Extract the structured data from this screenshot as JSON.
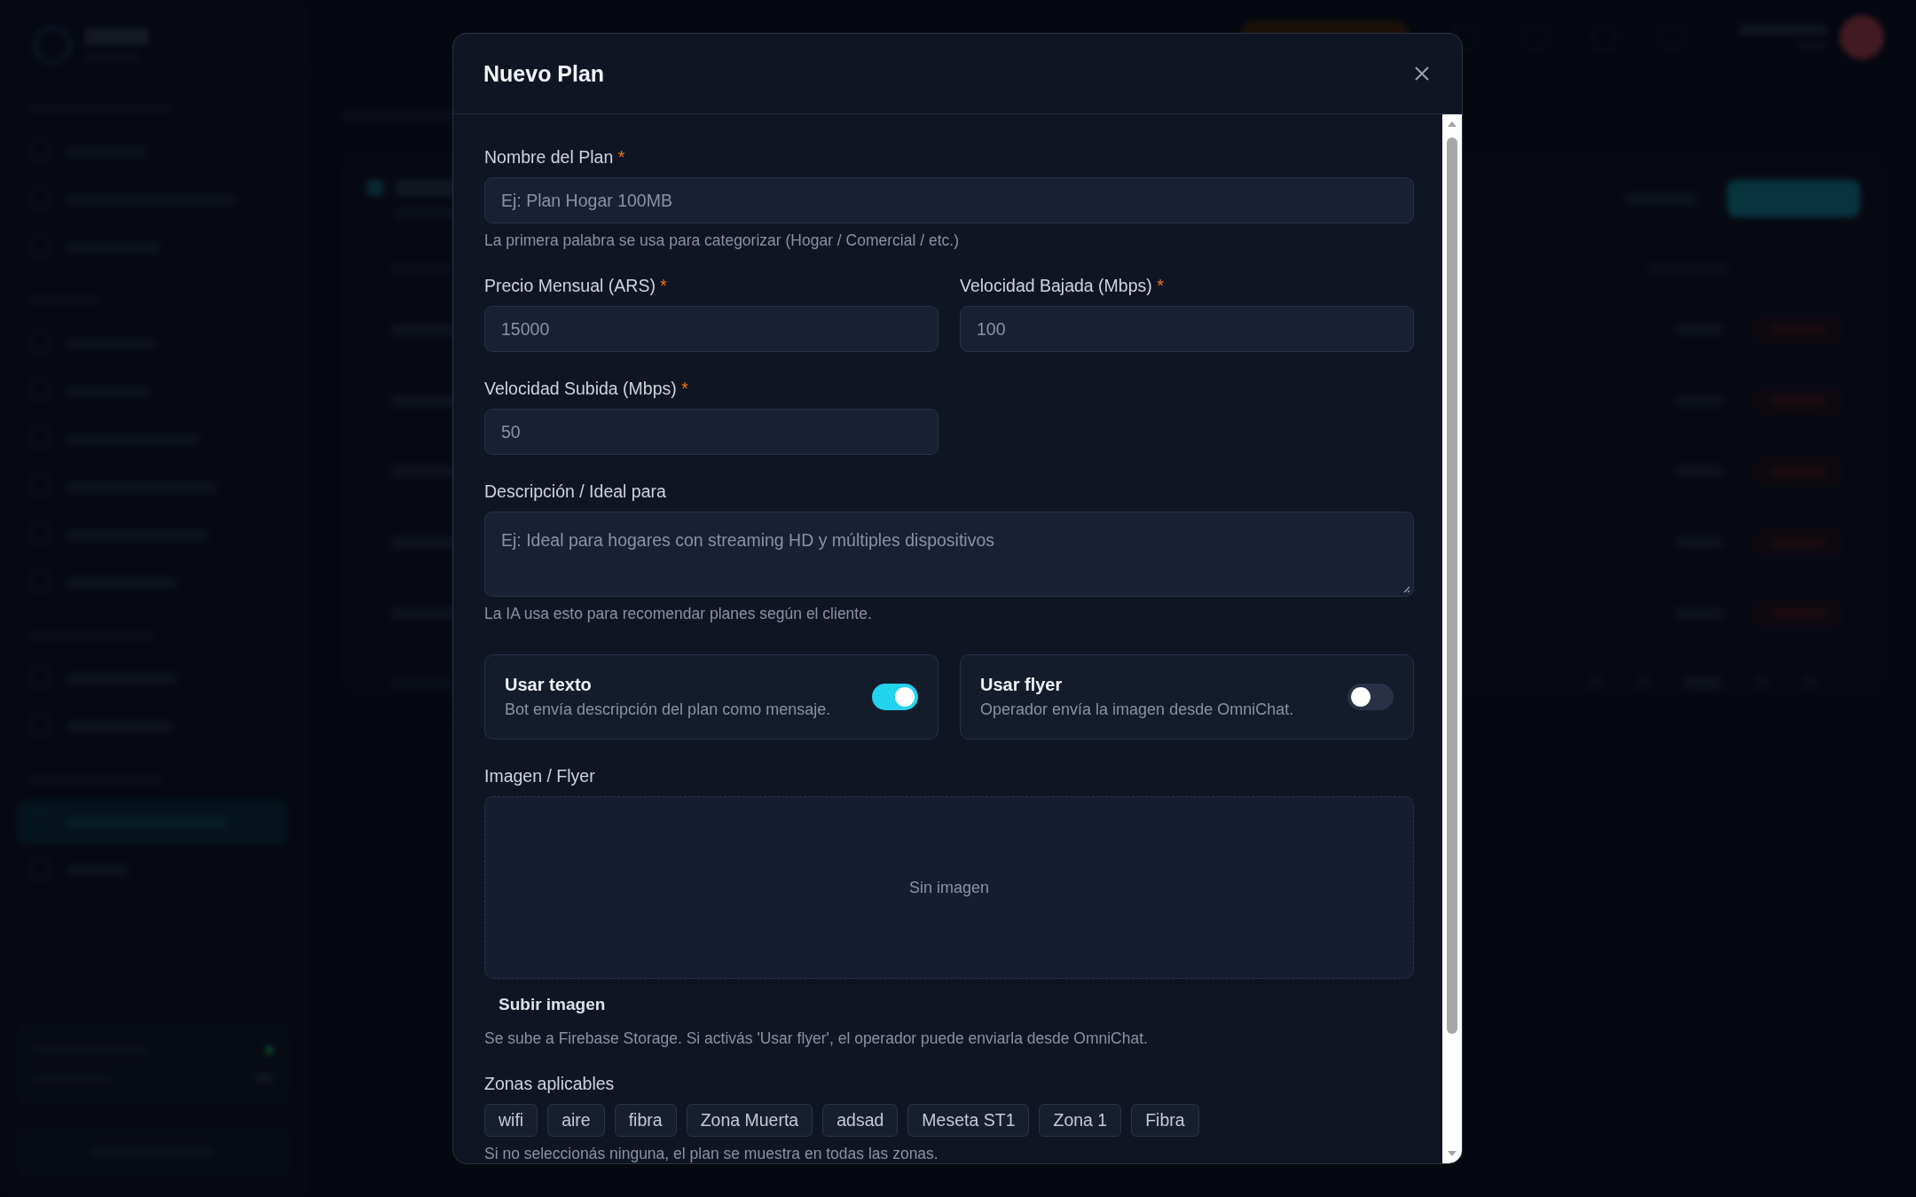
{
  "modal": {
    "title": "Nuevo Plan",
    "fields": [
      {
        "label": "Nombre del Plan",
        "required_mark": "*",
        "placeholder": "Ej: Plan Hogar 100MB",
        "hint": "La primera palabra se usa para categorizar (Hogar / Comercial / etc.)",
        "kind": "text"
      },
      {
        "label": "Precio Mensual (ARS)",
        "required_mark": "*",
        "placeholder": "15000",
        "kind": "half"
      },
      {
        "label": "Velocidad Bajada (Mbps)",
        "required_mark": "*",
        "placeholder": "100",
        "kind": "half"
      },
      {
        "label": "Velocidad Subida (Mbps)",
        "required_mark": "*",
        "placeholder": "50",
        "kind": "half"
      },
      {
        "label": "Descripción / Ideal para",
        "placeholder": "Ej: Ideal para hogares con streaming HD y múltiples dispositivos",
        "hint": "La IA usa esto para recomendar planes según el cliente.",
        "kind": "textarea"
      }
    ],
    "toggles": [
      {
        "title": "Usar texto",
        "description": "Bot envía descripción del plan como mensaje.",
        "on": true
      },
      {
        "title": "Usar flyer",
        "description": "Operador envía la imagen desde OmniChat.",
        "on": false
      }
    ],
    "image": {
      "label": "Imagen / Flyer",
      "empty_text": "Sin imagen",
      "upload": "Subir imagen",
      "hint": "Se sube a Firebase Storage. Si activás 'Usar flyer', el operador puede enviarla desde OmniChat."
    },
    "zones": {
      "label": "Zonas aplicables",
      "items": [
        {
          "label": "wifi",
          "selected": false
        },
        {
          "label": "aire",
          "selected": false
        },
        {
          "label": "fibra",
          "selected": false
        },
        {
          "label": "Zona Muerta",
          "selected": false
        },
        {
          "label": "adsad",
          "selected": false
        },
        {
          "label": "Meseta ST1",
          "selected": false
        },
        {
          "label": "Zona 1",
          "selected": false
        },
        {
          "label": "Fibra",
          "selected": false
        }
      ],
      "hint": "Si no seleccionás ninguna, el plan se muestra en todas las zonas."
    }
  }
}
